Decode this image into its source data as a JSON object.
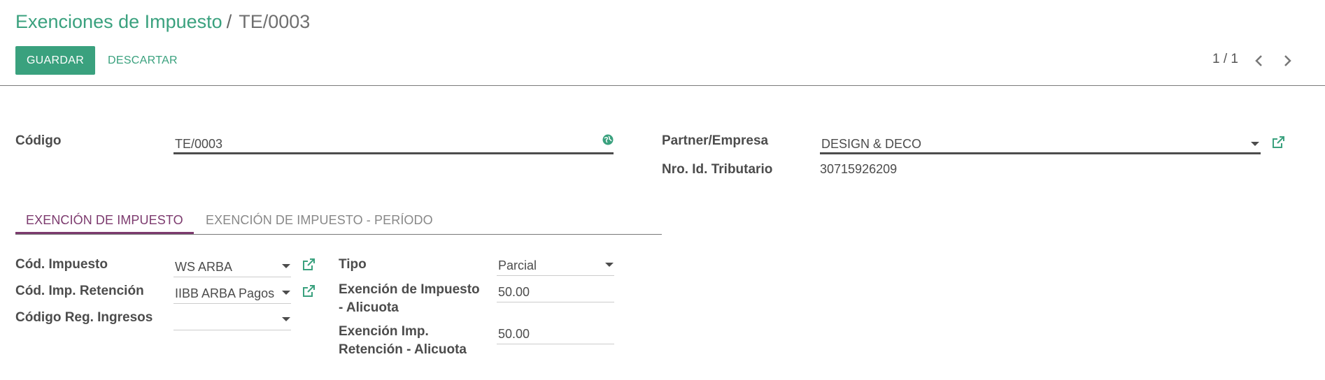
{
  "breadcrumb": {
    "parent": "Exenciones de Impuesto",
    "separator": "/",
    "current": "TE/0003"
  },
  "toolbar": {
    "save_label": "GUARDAR",
    "discard_label": "DESCARTAR"
  },
  "pager": {
    "value": "1 / 1"
  },
  "colors": {
    "primary": "#3aa17e",
    "tab_active": "#7c3a6e"
  },
  "form": {
    "codigo": {
      "label": "Código",
      "value": "TE/0003"
    },
    "partner": {
      "label": "Partner/Empresa",
      "value": "DESIGN & DECO"
    },
    "nro_id": {
      "label": "Nro. Id. Tributario",
      "value": "30715926209"
    }
  },
  "tabs": [
    {
      "label": "EXENCIÓN DE IMPUESTO",
      "active": true
    },
    {
      "label": "EXENCIÓN DE IMPUESTO - PERÍODO",
      "active": false
    }
  ],
  "tab_fields": {
    "cod_impuesto": {
      "label": "Cód. Impuesto",
      "value": "WS ARBA"
    },
    "cod_imp_retencion": {
      "label": "Cód. Imp. Retención",
      "value": "IIBB ARBA Pagos"
    },
    "codigo_reg_ingresos": {
      "label": "Código Reg. Ingresos",
      "value": ""
    },
    "tipo": {
      "label": "Tipo",
      "value": "Parcial"
    },
    "exencion_alicuota": {
      "label_1": "Exención de Impuesto",
      "label_2": "- Alicuota",
      "value": "50.00"
    },
    "exencion_ret_alicuota": {
      "label_1": "Exención Imp.",
      "label_2": "Retención - Alicuota",
      "value": "50.00"
    }
  }
}
